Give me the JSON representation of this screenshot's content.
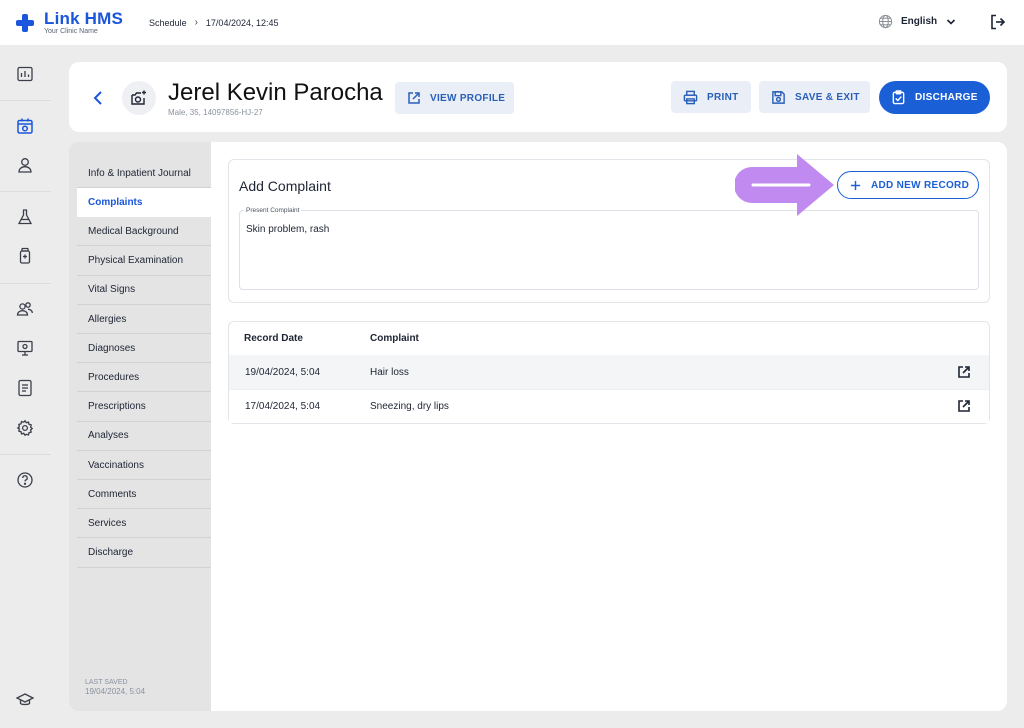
{
  "app": {
    "name": "Link HMS",
    "clinic_name": "Your Clinic Name"
  },
  "topbar": {
    "breadcrumb_section": "Schedule",
    "breadcrumb_datetime": "17/04/2024, 12:45",
    "language": "English"
  },
  "rail": {
    "icons": [
      "dashboard-icon",
      "calendar-icon",
      "user-icon",
      "lab-flask-icon",
      "medicine-bottle-icon",
      "users-group-icon",
      "monitor-icon",
      "report-icon",
      "settings-icon",
      "help-icon",
      "graduation-cap-icon"
    ],
    "active": "calendar-icon"
  },
  "patient": {
    "name": "Jerel Kevin Parocha",
    "meta": "Male, 35, 14097856-HJ-27"
  },
  "actions": {
    "view_profile": "VIEW PROFILE",
    "print": "PRINT",
    "save_exit": "SAVE & EXIT",
    "discharge": "DISCHARGE"
  },
  "subnav": {
    "items": [
      {
        "label": "Info & Inpatient Journal",
        "active": false
      },
      {
        "label": "Complaints",
        "active": true
      },
      {
        "label": "Medical Background",
        "active": false
      },
      {
        "label": "Physical Examination",
        "active": false
      },
      {
        "label": "Vital Signs",
        "active": false
      },
      {
        "label": "Allergies",
        "active": false
      },
      {
        "label": "Diagnoses",
        "active": false
      },
      {
        "label": "Procedures",
        "active": false
      },
      {
        "label": "Prescriptions",
        "active": false
      },
      {
        "label": "Analyses",
        "active": false
      },
      {
        "label": "Vaccinations",
        "active": false
      },
      {
        "label": "Comments",
        "active": false
      },
      {
        "label": "Services",
        "active": false
      },
      {
        "label": "Discharge",
        "active": false
      }
    ],
    "last_saved_label": "LAST SAVED",
    "last_saved_value": "19/04/2024, 5:04"
  },
  "complaint_form": {
    "title": "Add Complaint",
    "add_button": "ADD NEW RECORD",
    "field_label": "Present Complaint",
    "field_value": "Skin problem, rash"
  },
  "records": {
    "headers": [
      "Record Date",
      "Complaint"
    ],
    "rows": [
      {
        "date": "19/04/2024, 5:04",
        "complaint": "Hair loss"
      },
      {
        "date": "17/04/2024, 5:04",
        "complaint": "Sneezing, dry lips"
      }
    ]
  },
  "colors": {
    "primary": "#1a5fd6",
    "highlight_arrow": "#c08af0",
    "surface": "#ececec"
  }
}
